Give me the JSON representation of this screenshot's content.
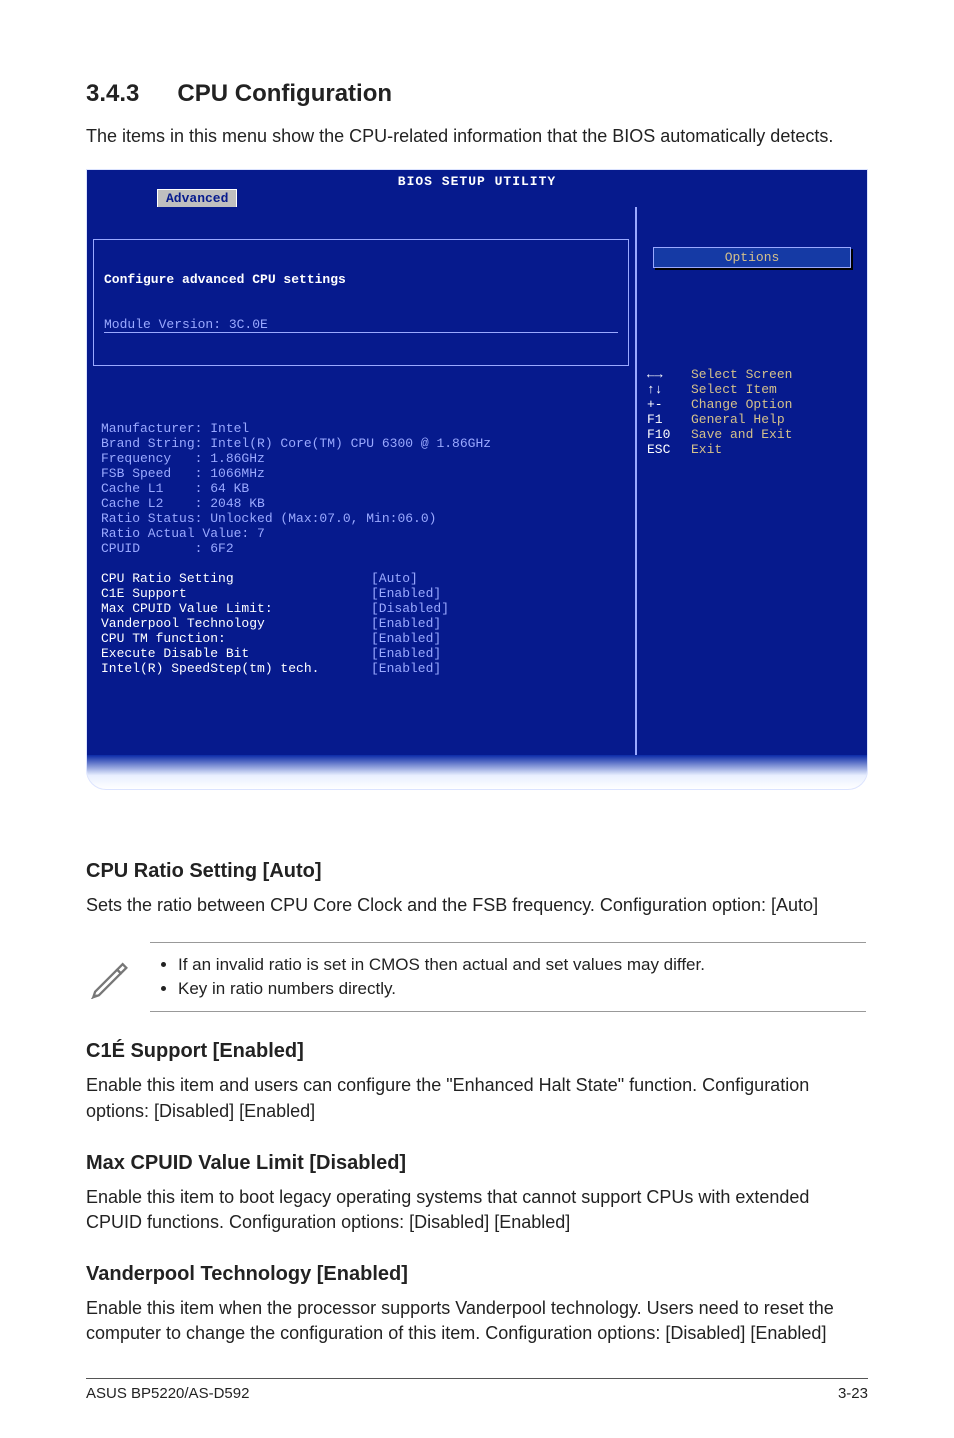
{
  "section_number": "3.4.3",
  "section_title": "CPU Configuration",
  "intro": "The items in this menu show the CPU-related information that the BIOS automatically detects.",
  "bios": {
    "title": "BIOS SETUP UTILITY",
    "tab": "Advanced",
    "box_title": "Configure advanced CPU settings",
    "module_line": "Module Version: 3C.0E",
    "info": [
      "Manufacturer: Intel",
      "Brand String: Intel(R) Core(TM) CPU 6300 @ 1.86GHz",
      "Frequency   : 1.86GHz",
      "FSB Speed   : 1066MHz",
      "Cache L1    : 64 KB",
      "Cache L2    : 2048 KB",
      "Ratio Status: Unlocked (Max:07.0, Min:06.0)",
      "Ratio Actual Value: 7",
      "CPUID       : 6F2"
    ],
    "settings": [
      {
        "label": "CPU Ratio Setting",
        "value": "[Auto]"
      },
      {
        "label": "C1E Support",
        "value": "[Enabled]"
      },
      {
        "label": "Max CPUID Value Limit:",
        "value": "[Disabled]"
      },
      {
        "label": "Vanderpool Technology",
        "value": "[Enabled]"
      },
      {
        "label": "CPU TM function:",
        "value": "[Enabled]"
      },
      {
        "label": "Execute Disable Bit",
        "value": "[Enabled]"
      },
      {
        "label": "Intel(R) SpeedStep(tm) tech.",
        "value": "[Enabled]"
      }
    ],
    "options_title": "Options",
    "legend": [
      {
        "key": "←→",
        "label": "Select Screen"
      },
      {
        "key": "↑↓",
        "label": "Select Item"
      },
      {
        "key": "+-",
        "label": "Change Option"
      },
      {
        "key": "F1",
        "label": "General Help"
      },
      {
        "key": "F10",
        "label": "Save and Exit"
      },
      {
        "key": "ESC",
        "label": "Exit"
      }
    ]
  },
  "sub1": {
    "heading": "CPU Ratio Setting [Auto]",
    "body": "Sets the ratio between CPU Core Clock and the FSB frequency. Configuration option: [Auto]"
  },
  "note": {
    "items": [
      "If an invalid ratio is set in CMOS then actual and set values may differ.",
      "Key in ratio numbers directly."
    ]
  },
  "sub2": {
    "heading": "C1É Support [Enabled]",
    "body": "Enable this item and users can configure the \"Enhanced Halt State\" function. Configuration options: [Disabled] [Enabled]"
  },
  "sub3": {
    "heading": "Max CPUID Value Limit [Disabled]",
    "body": "Enable this item to boot legacy operating systems that cannot support CPUs with extended CPUID functions. Configuration options: [Disabled] [Enabled]"
  },
  "sub4": {
    "heading": "Vanderpool Technology [Enabled]",
    "body": "Enable this item when the processor supports Vanderpool technology. Users need to reset the computer to change the configuration of this item. Configuration options: [Disabled] [Enabled]"
  },
  "footer": {
    "left": "ASUS BP5220/AS-D592",
    "right": "3-23"
  }
}
